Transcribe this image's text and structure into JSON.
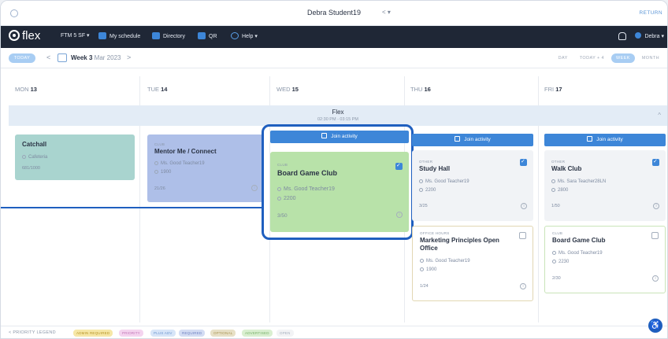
{
  "window": {
    "title": "Debra Student19",
    "caret": "< ▾",
    "return_label": "RETURN"
  },
  "nav": {
    "logo": "flex",
    "items": [
      "FTM 5 SF ▾",
      "My schedule",
      "Directory",
      "QR",
      "Help ▾"
    ],
    "user": "Debra ▾"
  },
  "toolbar": {
    "today": "TODAY",
    "prev": "<",
    "next": ">",
    "week_bold": "Week 3",
    "week_rest": "Mar 2023",
    "views": [
      "DAY",
      "TODAY + 4",
      "WEEK",
      "MONTH"
    ],
    "active_view": "WEEK"
  },
  "days": [
    {
      "dow": "MON",
      "num": "13"
    },
    {
      "dow": "TUE",
      "num": "14"
    },
    {
      "dow": "WED",
      "num": "15"
    },
    {
      "dow": "THU",
      "num": "16"
    },
    {
      "dow": "FRI",
      "num": "17"
    }
  ],
  "flex": {
    "title": "Flex",
    "time": "02:30 PM - 03:15 PM"
  },
  "cards": {
    "mon": {
      "title": "Catchall",
      "location": "Cafeteria",
      "capacity": "681/1000"
    },
    "tue": {
      "tag": "CLUB",
      "title": "Mentor Me / Connect",
      "teacher": "Ms. Good Teacher19",
      "room": "1900",
      "capacity": "21/26"
    },
    "wed": {
      "join": "Join activity",
      "tag": "CLUB",
      "title": "Board Game Club",
      "teacher": "Ms. Good Teacher19",
      "room": "2200",
      "capacity": "3/50"
    },
    "thu": {
      "join": "Join activity",
      "first": {
        "tag": "OTHER",
        "title": "Study Hall",
        "teacher": "Ms. Good Teacher19",
        "room": "2200",
        "capacity": "3/25"
      },
      "second": {
        "tag": "OFFICE HOURS",
        "title": "Marketing Principles Open Office",
        "teacher": "Ms. Good Teacher19",
        "room": "1900",
        "capacity": "1/24"
      }
    },
    "fri": {
      "join": "Join activity",
      "first": {
        "tag": "OTHER",
        "title": "Walk Club",
        "teacher": "Ms. Sara Teacher28LN",
        "room": "2800",
        "capacity": "1/50"
      },
      "second": {
        "tag": "CLUB",
        "title": "Board Game Club",
        "teacher": "Ms. Good Teacher19",
        "room": "2230",
        "capacity": "2/30"
      }
    }
  },
  "legend": {
    "label": "PRIORITY LEGEND",
    "items": [
      "ADMIN REQUIRED",
      "PRIORITY",
      "PLUS ADV",
      "REQUIRED",
      "OPTIONAL",
      "ADVERTISED",
      "OPEN"
    ]
  },
  "colors": {
    "nav_bg": "#1f2736",
    "accent": "#3d86d8",
    "highlight": "#1f5fbf",
    "mon_card": "#a9d4cf",
    "tue_card": "#aebfe8",
    "wed_card": "#b8e2a9"
  }
}
